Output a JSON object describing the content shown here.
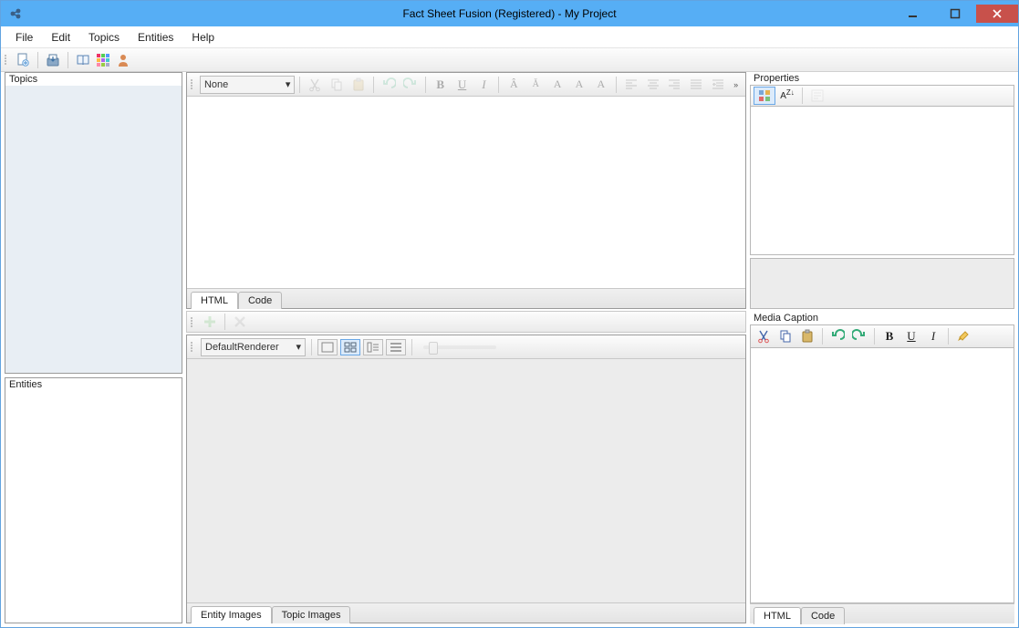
{
  "window": {
    "title": "Fact Sheet Fusion (Registered) - My Project"
  },
  "menu": {
    "file": "File",
    "edit": "Edit",
    "topics": "Topics",
    "entities": "Entities",
    "help": "Help"
  },
  "left": {
    "topics_label": "Topics",
    "entities_label": "Entities"
  },
  "editor": {
    "font_combo": "None",
    "tabs": {
      "html": "HTML",
      "code": "Code"
    }
  },
  "lower": {
    "renderer_combo": "DefaultRenderer",
    "tabs": {
      "entity_images": "Entity Images",
      "topic_images": "Topic Images"
    }
  },
  "properties": {
    "title": "Properties"
  },
  "media_caption": {
    "title": "Media Caption",
    "tabs": {
      "html": "HTML",
      "code": "Code"
    }
  },
  "icons": {
    "app": "fsf-app",
    "new_doc": "new-document",
    "export": "export",
    "book": "open-book",
    "grid": "color-grid",
    "user": "user",
    "cut": "cut",
    "copy": "copy",
    "paste": "paste",
    "undo": "undo",
    "redo": "redo",
    "bold": "B",
    "underline": "U",
    "italic": "I",
    "align_left": "align-left",
    "align_center": "align-center",
    "align_right": "align-right",
    "align_justify": "align-justify",
    "indent": "indent",
    "plus": "plus",
    "delete": "delete",
    "props_cat": "categorized",
    "props_az": "alphabetical",
    "props_pages": "property-pages",
    "brush": "format-brush"
  },
  "colors": {
    "titlebar": "#56aef5",
    "close": "#c8514b",
    "accent": "#6aa7e6"
  }
}
